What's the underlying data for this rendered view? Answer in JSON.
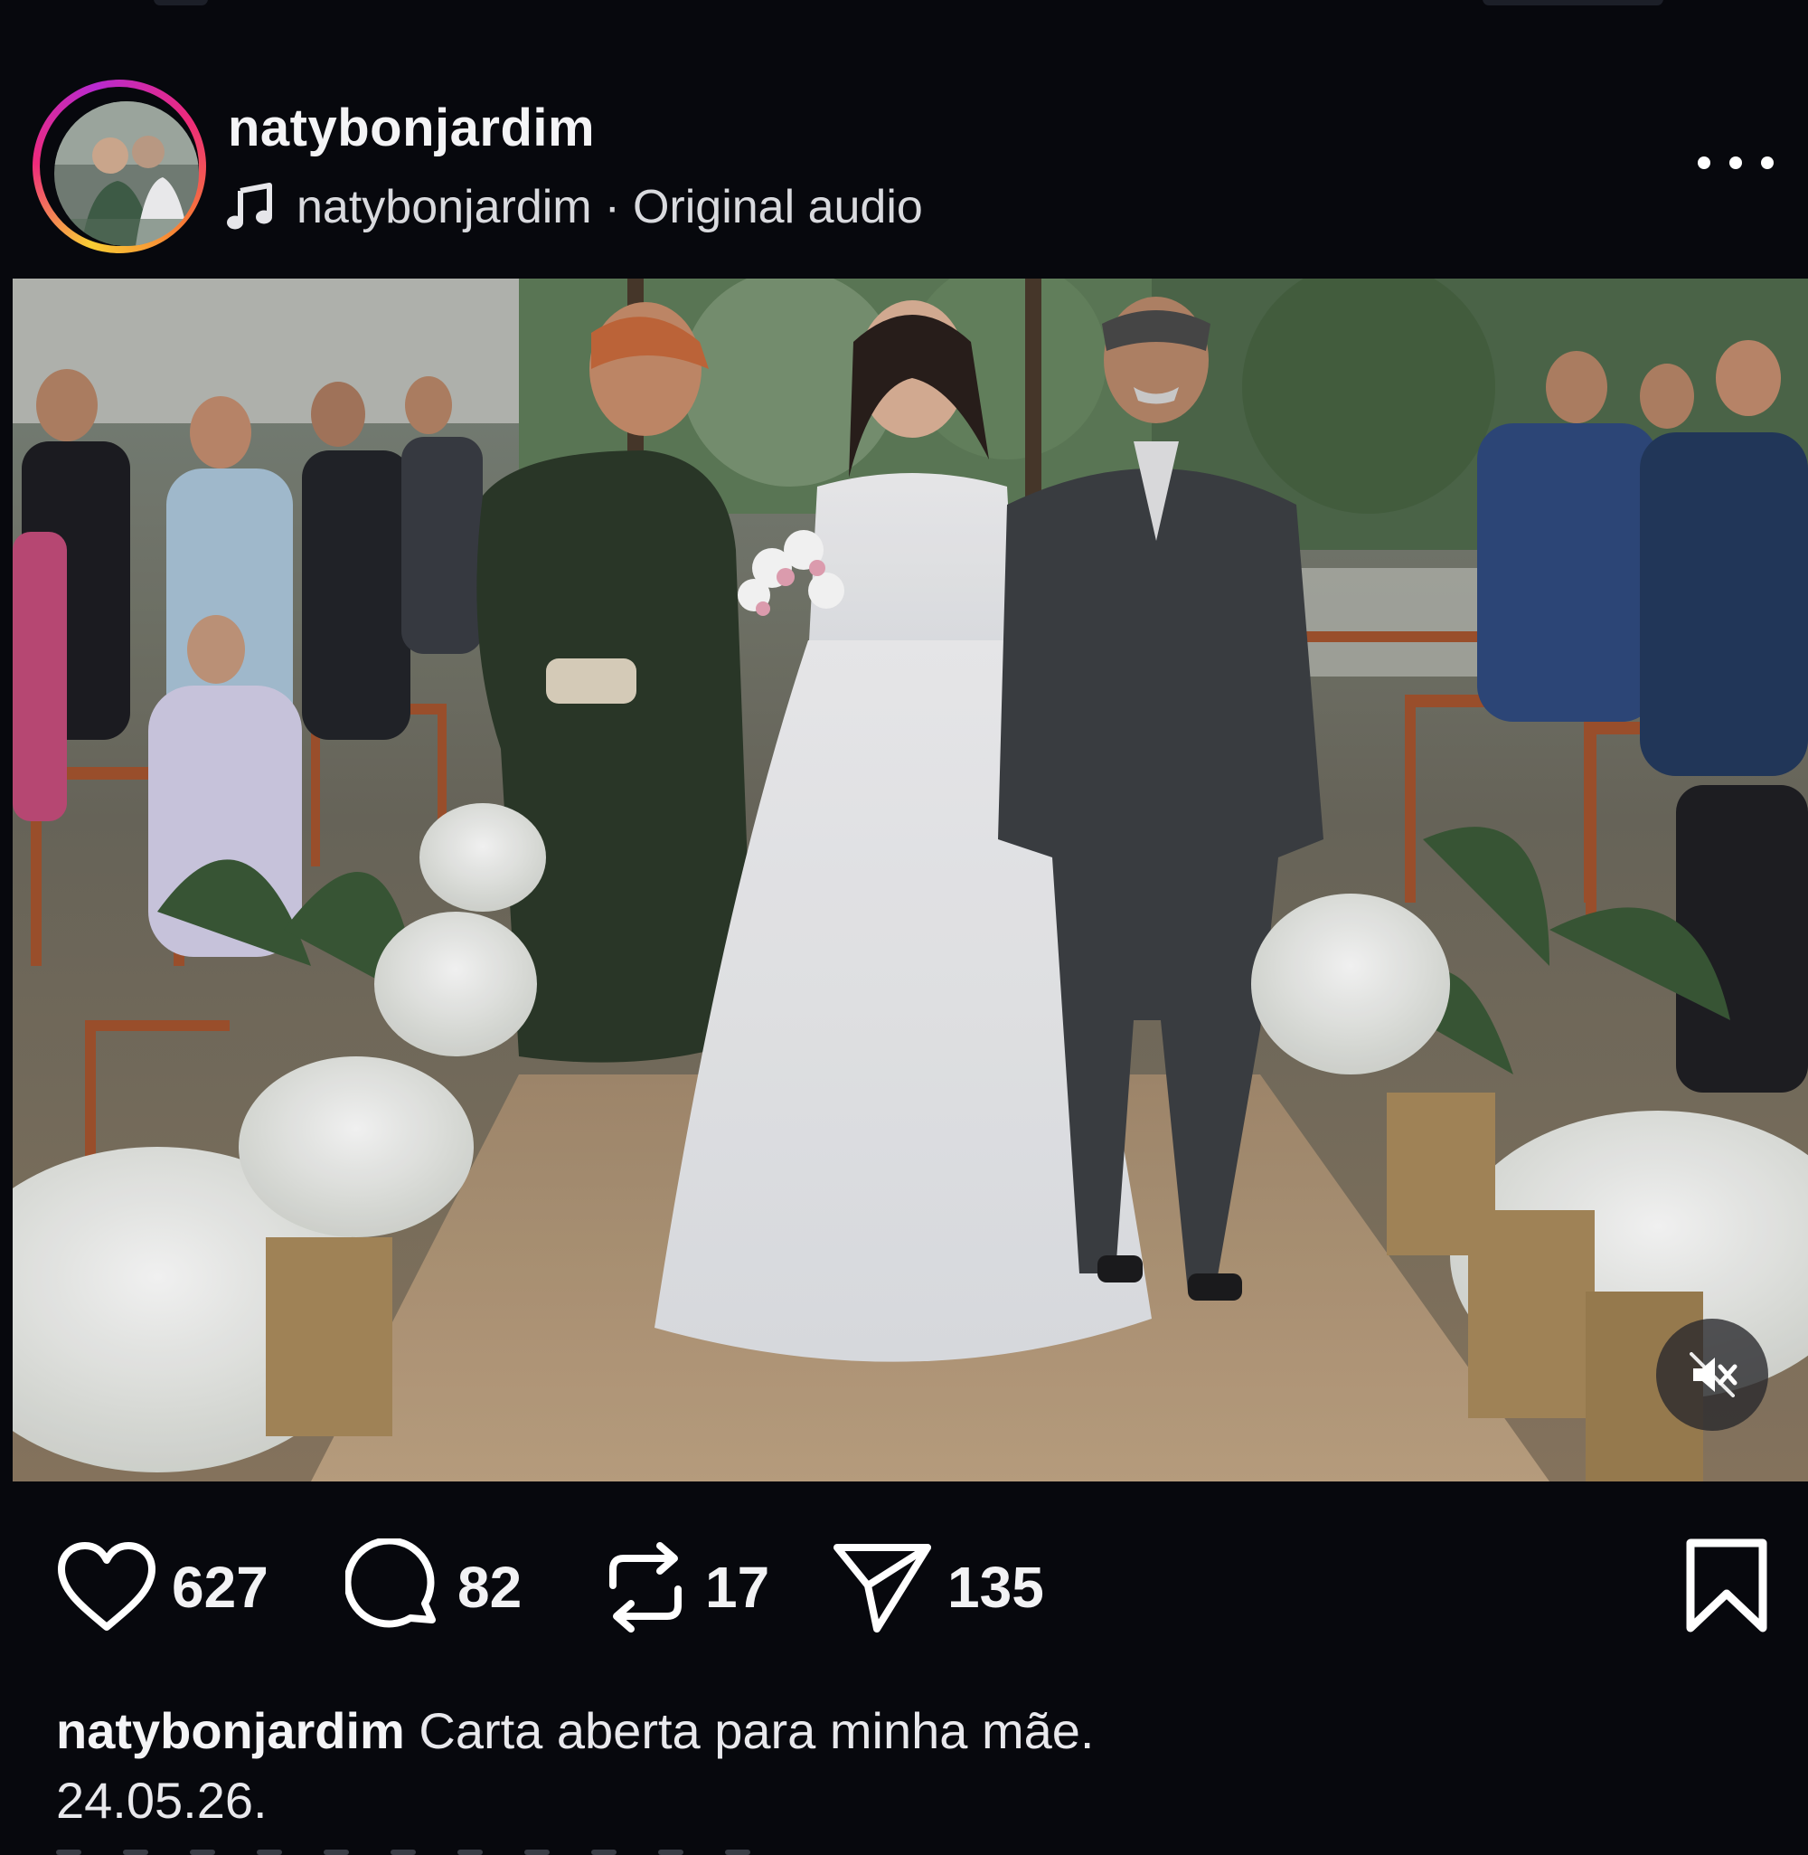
{
  "post": {
    "username": "natybonjardim",
    "audio": {
      "artist": "natybonjardim",
      "separator": "·",
      "label": "Original audio"
    }
  },
  "actions": {
    "likes": "627",
    "comments": "82",
    "reposts": "17",
    "shares": "135"
  },
  "caption": {
    "username": "natybonjardim",
    "text": "Carta aberta para minha mãe.",
    "date": "24.05.26."
  },
  "colors": {
    "background": "#07080d",
    "text": "#ffffff",
    "ring_gradient": [
      "#f9ce34",
      "#ee2a7b",
      "#b82ad0"
    ]
  },
  "icons": {
    "music": "music-note-icon",
    "more": "more-options-icon",
    "like": "heart-icon",
    "comment": "comment-bubble-icon",
    "repost": "repost-icon",
    "share": "paper-plane-icon",
    "save": "bookmark-icon",
    "mute": "speaker-muted-icon"
  }
}
